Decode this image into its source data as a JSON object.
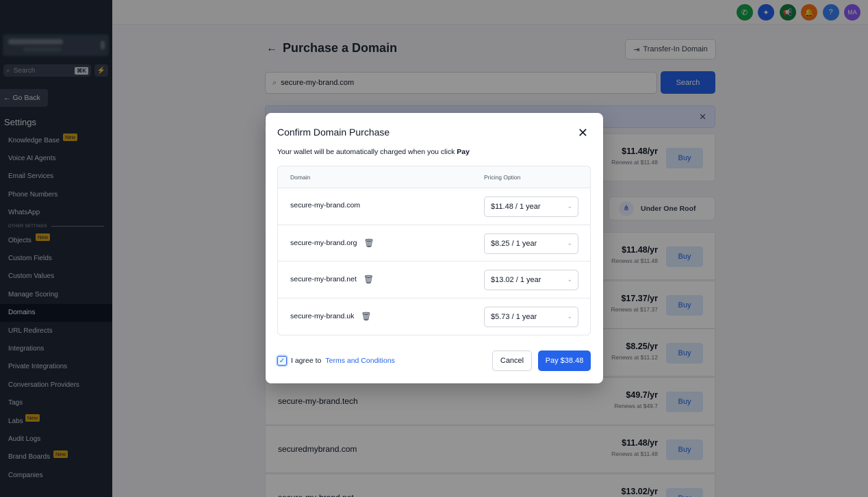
{
  "sidebar": {
    "search_placeholder": "Search",
    "search_shortcut": "⌘K",
    "go_back": "Go Back",
    "settings_title": "Settings",
    "items_top": [
      {
        "label": "Knowledge Base",
        "badge": "New"
      },
      {
        "label": "Voice AI Agents"
      },
      {
        "label": "Email Services"
      },
      {
        "label": "Phone Numbers"
      },
      {
        "label": "WhatsApp"
      }
    ],
    "section_label": "OTHER SETTINGS",
    "items_bottom": [
      {
        "label": "Objects",
        "badge": "New"
      },
      {
        "label": "Custom Fields"
      },
      {
        "label": "Custom Values"
      },
      {
        "label": "Manage Scoring"
      },
      {
        "label": "Domains",
        "active": true
      },
      {
        "label": "URL Redirects"
      },
      {
        "label": "Integrations"
      },
      {
        "label": "Private Integrations"
      },
      {
        "label": "Conversation Providers"
      },
      {
        "label": "Tags"
      },
      {
        "label": "Labs",
        "badge": "New"
      },
      {
        "label": "Audit Logs"
      },
      {
        "label": "Brand Boards",
        "badge": "New"
      },
      {
        "label": "Companies"
      }
    ]
  },
  "topbar": {
    "icons": [
      {
        "name": "phone-icon",
        "color": "#16a34a",
        "glyph": "✆"
      },
      {
        "name": "sparkle-icon",
        "color": "#2563eb",
        "glyph": "✦"
      },
      {
        "name": "megaphone-icon",
        "color": "#15803d",
        "glyph": "📢",
        "dot": true
      },
      {
        "name": "bell-icon",
        "color": "#f97316",
        "glyph": "🔔"
      },
      {
        "name": "help-icon",
        "color": "#3b82f6",
        "glyph": "?"
      },
      {
        "name": "avatar",
        "color": "#8b5cf6",
        "glyph": "MA"
      }
    ]
  },
  "main": {
    "title": "Purchase a Domain",
    "transfer_label": "Transfer-In Domain",
    "search_value": "secure-my-brand.com",
    "search_button": "Search",
    "roof_label": "Under One Roof",
    "results": [
      {
        "domain": "",
        "price": "$11.48/yr",
        "renews": "Renews at $11.48",
        "buy": "Buy"
      },
      {
        "domain": "",
        "price": "$11.48/yr",
        "renews": "Renews at $11.48",
        "buy": "Buy"
      },
      {
        "domain": "",
        "price": "$17.37/yr",
        "renews": "Renews at $17.37",
        "buy": "Buy"
      },
      {
        "domain": "",
        "price": "$8.25/yr",
        "renews": "Renews at $11.12",
        "buy": "Buy"
      },
      {
        "domain": "secure-my-brand.tech",
        "price": "$49.7/yr",
        "renews": "Renews at $49.7",
        "buy": "Buy"
      },
      {
        "domain": "securedmybrand.com",
        "price": "$11.48/yr",
        "renews": "Renews at $11.48",
        "buy": "Buy"
      },
      {
        "domain": "secure-my-brand.net",
        "price": "$13.02/yr",
        "renews": "",
        "buy": "Buy"
      }
    ]
  },
  "modal": {
    "title": "Confirm Domain Purchase",
    "subtitle_prefix": "Your wallet will be automatically charged when you click ",
    "subtitle_bold": "Pay",
    "col_domain": "Domain",
    "col_pricing": "Pricing Option",
    "rows": [
      {
        "domain": "secure-my-brand.com",
        "option": "$11.48 / 1 year",
        "deletable": false
      },
      {
        "domain": "secure-my-brand.org",
        "option": "$8.25 / 1 year",
        "deletable": true
      },
      {
        "domain": "secure-my-brand.net",
        "option": "$13.02 / 1 year",
        "deletable": true
      },
      {
        "domain": "secure-my-brand.uk",
        "option": "$5.73 / 1 year",
        "deletable": true
      }
    ],
    "agree_text": "I agree to",
    "terms_link": "Terms and Conditions",
    "agree_checked": true,
    "cancel_label": "Cancel",
    "pay_label": "Pay $38.48"
  }
}
